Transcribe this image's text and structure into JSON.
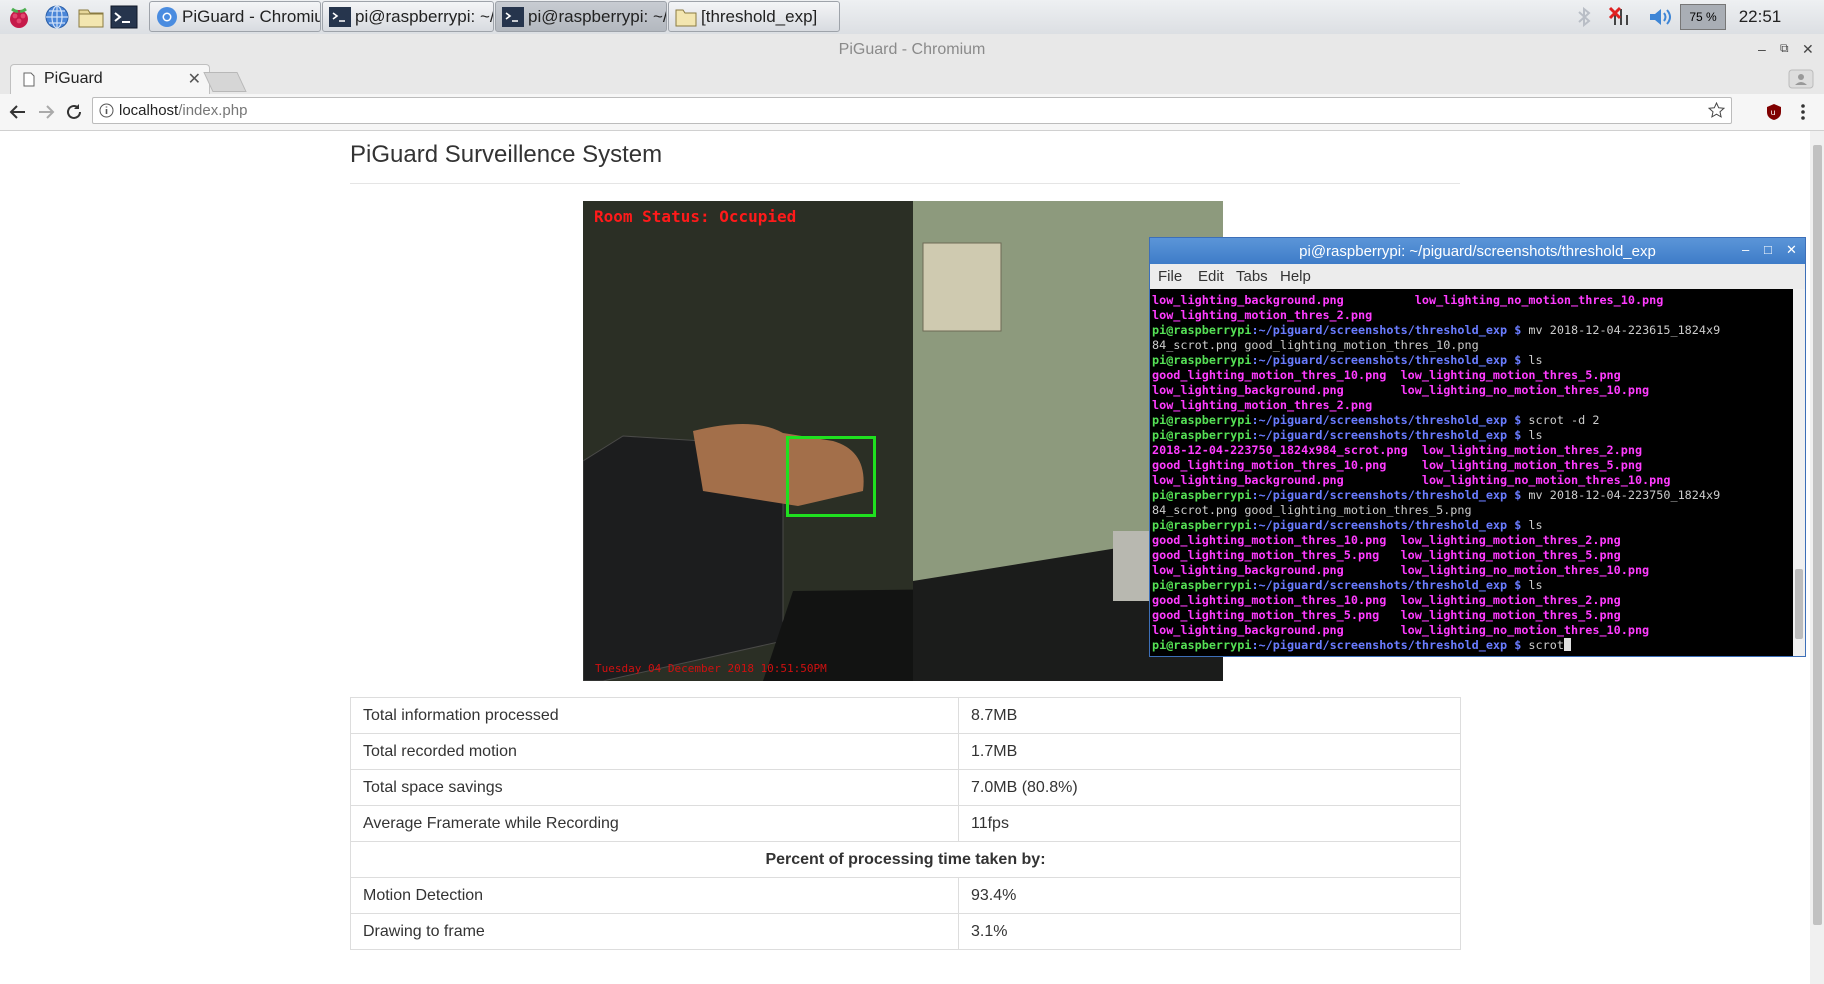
{
  "taskbar": {
    "launchers": [
      "raspberry-menu-icon",
      "web-browser-icon",
      "file-manager-icon",
      "terminal-icon"
    ],
    "tasks": [
      {
        "label": "PiGuard - Chromium",
        "icon": "chromium-icon"
      },
      {
        "label": "pi@raspberrypi: ~/pig...",
        "icon": "terminal-icon"
      },
      {
        "label": "pi@raspberrypi: ~/pig...",
        "icon": "terminal-icon"
      },
      {
        "label": "[threshold_exp]",
        "icon": "folder-icon"
      }
    ],
    "cpu_percent": "75 %",
    "clock": "22:51"
  },
  "browser": {
    "window_title": "PiGuard - Chromium",
    "tab_title": "PiGuard",
    "url_host": "localhost",
    "url_path": "/index.php"
  },
  "page": {
    "title": "PiGuard Surveillence System",
    "camera": {
      "room_status": "Room Status: Occupied",
      "timestamp": "Tuesday 04 December 2018 10:51:50PM"
    },
    "stats": [
      {
        "label": "Total information processed",
        "value": "8.7MB"
      },
      {
        "label": "Total recorded motion",
        "value": "1.7MB"
      },
      {
        "label": "Total space savings",
        "value": "7.0MB (80.8%)"
      },
      {
        "label": "Average Framerate while Recording",
        "value": "11fps"
      }
    ],
    "section_header": "Percent of processing time taken by:",
    "breakdown": [
      {
        "label": "Motion Detection",
        "value": "93.4%"
      },
      {
        "label": "Drawing to frame",
        "value": "3.1%"
      }
    ]
  },
  "terminal": {
    "title": "pi@raspberrypi: ~/piguard/screenshots/threshold_exp",
    "menu": [
      "File",
      "Edit",
      "Tabs",
      "Help"
    ],
    "prompt_user": "pi@raspberrypi",
    "prompt_path": ":~/piguard/screenshots/threshold_exp $",
    "lines": [
      {
        "kind": "files",
        "text": "low_lighting_background.png          low_lighting_no_motion_thres_10.png"
      },
      {
        "kind": "files",
        "text": "low_lighting_motion_thres_2.png"
      },
      {
        "kind": "cmd",
        "text": " mv 2018-12-04-223615_1824x9"
      },
      {
        "kind": "plain",
        "text": "84_scrot.png good_lighting_motion_thres_10.png"
      },
      {
        "kind": "cmd",
        "text": " ls"
      },
      {
        "kind": "files",
        "text": "good_lighting_motion_thres_10.png  low_lighting_motion_thres_5.png"
      },
      {
        "kind": "files",
        "text": "low_lighting_background.png        low_lighting_no_motion_thres_10.png"
      },
      {
        "kind": "files",
        "text": "low_lighting_motion_thres_2.png"
      },
      {
        "kind": "cmd",
        "text": " scrot -d 2"
      },
      {
        "kind": "cmd",
        "text": " ls"
      },
      {
        "kind": "files",
        "text": "2018-12-04-223750_1824x984_scrot.png  low_lighting_motion_thres_2.png"
      },
      {
        "kind": "files",
        "text": "good_lighting_motion_thres_10.png     low_lighting_motion_thres_5.png"
      },
      {
        "kind": "files",
        "text": "low_lighting_background.png           low_lighting_no_motion_thres_10.png"
      },
      {
        "kind": "cmd",
        "text": " mv 2018-12-04-223750_1824x9"
      },
      {
        "kind": "plain",
        "text": "84_scrot.png good_lighting_motion_thres_5.png"
      },
      {
        "kind": "cmd",
        "text": " ls"
      },
      {
        "kind": "files",
        "text": "good_lighting_motion_thres_10.png  low_lighting_motion_thres_2.png"
      },
      {
        "kind": "files",
        "text": "good_lighting_motion_thres_5.png   low_lighting_motion_thres_5.png"
      },
      {
        "kind": "files",
        "text": "low_lighting_background.png        low_lighting_no_motion_thres_10.png"
      },
      {
        "kind": "cmd",
        "text": " ls"
      },
      {
        "kind": "files",
        "text": "good_lighting_motion_thres_10.png  low_lighting_motion_thres_2.png"
      },
      {
        "kind": "files",
        "text": "good_lighting_motion_thres_5.png   low_lighting_motion_thres_5.png"
      },
      {
        "kind": "files",
        "text": "low_lighting_background.png        low_lighting_no_motion_thres_10.png"
      },
      {
        "kind": "active",
        "text": " scrot"
      }
    ]
  },
  "colors": {
    "prompt_user": "#55e055",
    "prompt_path": "#6a7cff",
    "file_listing": "#ff3cff",
    "room_status": "#ff1a1a",
    "motion_box": "#1fe01f",
    "terminal_titlebar": "#4a88d0"
  }
}
